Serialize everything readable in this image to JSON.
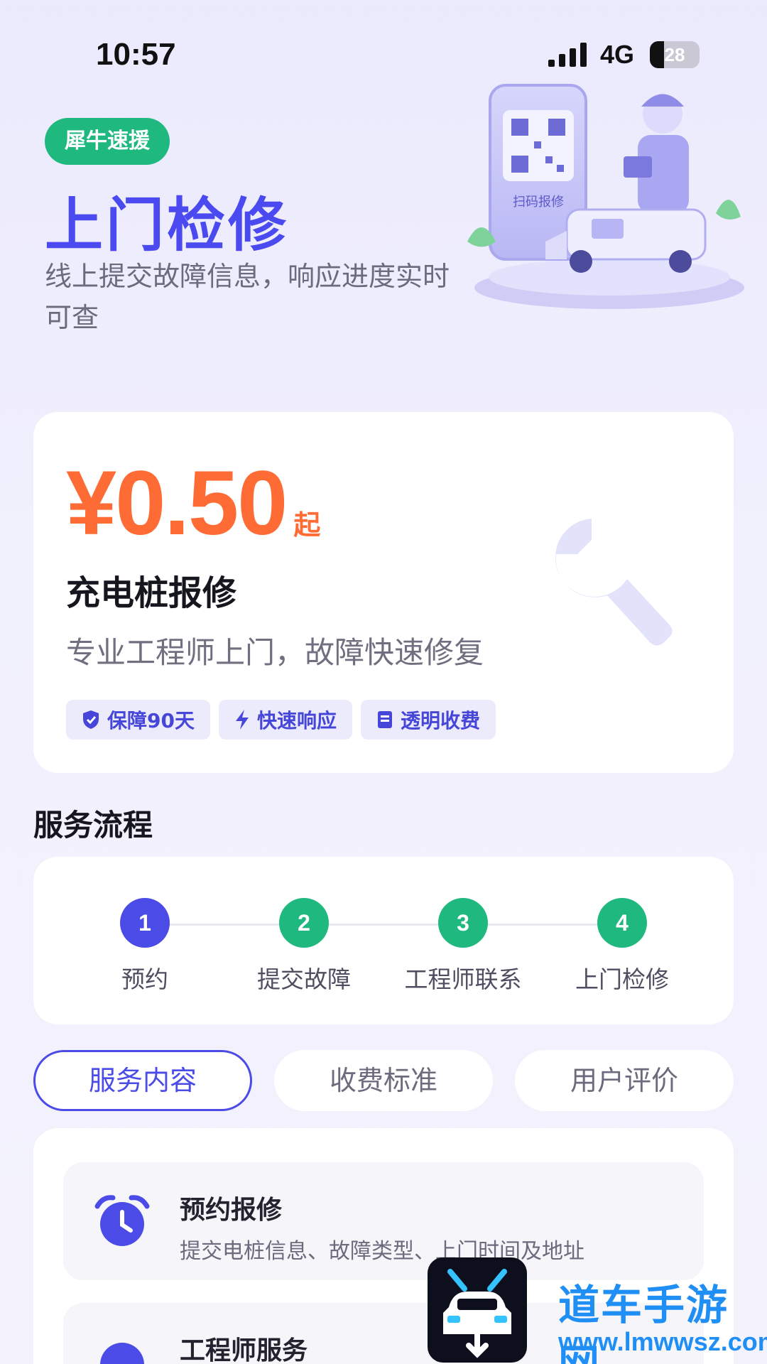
{
  "status_bar": {
    "time": "10:57",
    "network": "4G",
    "battery_level": "28"
  },
  "hero": {
    "brand_badge": "犀牛速援",
    "title": "上门检修",
    "subtitle": "线上提交故障信息，响应进度实时可查",
    "illustration_caption": "扫码报修"
  },
  "price_card": {
    "price": "¥0.50",
    "price_suffix": "起",
    "title": "充电桩报修",
    "description": "专业工程师上门，故障快速修复",
    "tags": [
      {
        "icon": "shield-check-icon",
        "label": "保障90天"
      },
      {
        "icon": "lightning-icon",
        "label": "快速响应"
      },
      {
        "icon": "receipt-icon",
        "label": "透明收费"
      }
    ]
  },
  "process": {
    "heading": "服务流程",
    "steps": [
      {
        "number": "1",
        "label": "预约"
      },
      {
        "number": "2",
        "label": "提交故障"
      },
      {
        "number": "3",
        "label": "工程师联系"
      },
      {
        "number": "4",
        "label": "上门检修"
      }
    ]
  },
  "tabs": [
    {
      "label": "服务内容",
      "active": true
    },
    {
      "label": "收费标准",
      "active": false
    },
    {
      "label": "用户评价",
      "active": false
    }
  ],
  "content_items": [
    {
      "icon": "alarm-clock-icon",
      "title": "预约报修",
      "description": "提交电桩信息、故障类型、上门时间及地址"
    },
    {
      "icon": "engineer-icon",
      "title": "工程师服务",
      "description": ""
    }
  ],
  "watermark": {
    "title": "道车手游网",
    "url": "www.lmwwsz.com"
  },
  "colors": {
    "accent": "#4b4be8",
    "brand_green": "#1fb97f",
    "price_orange": "#ff6b35",
    "step_active": "#4b4be8",
    "step_inactive": "#1fb97f",
    "watermark_blue": "#1f8ef5"
  }
}
